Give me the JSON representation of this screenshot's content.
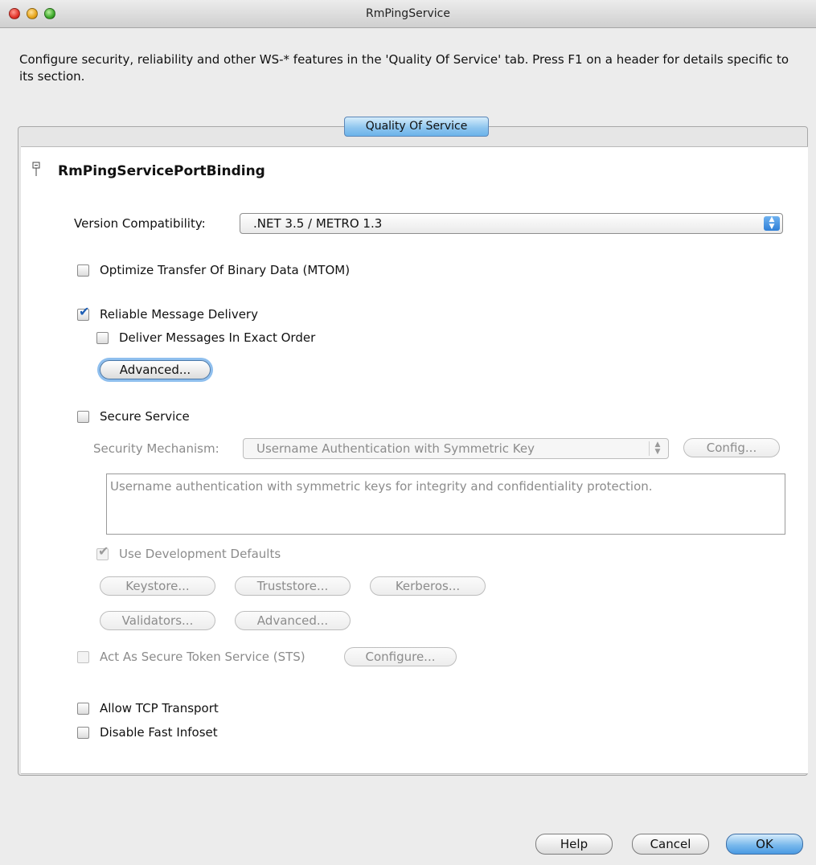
{
  "window": {
    "title": "RmPingService"
  },
  "intro_text": "Configure security, reliability and other WS-* features in the 'Quality Of Service' tab. Press F1 on a header for details specific to its section.",
  "tabs": [
    {
      "label": "Quality Of Service",
      "selected": true
    }
  ],
  "section": {
    "title": "RmPingServicePortBinding",
    "version": {
      "label": "Version Compatibility:",
      "value": ".NET 3.5 / METRO 1.3"
    },
    "mtom": {
      "label": "Optimize Transfer Of Binary Data (MTOM)",
      "checked": false
    },
    "reliable": {
      "label": "Reliable Message Delivery",
      "checked": true,
      "ordered": {
        "label": "Deliver Messages In Exact Order",
        "checked": false
      },
      "advanced_label": "Advanced..."
    },
    "secure": {
      "label": "Secure Service",
      "checked": false,
      "mechanism_label": "Security Mechanism:",
      "mechanism_value": "Username Authentication with Symmetric Key",
      "config_label": "Config...",
      "description": "Username authentication with symmetric keys for integrity and confidentiality protection.",
      "dev_defaults": {
        "label": "Use Development Defaults",
        "checked": true
      },
      "buttons": {
        "keystore": "Keystore...",
        "truststore": "Truststore...",
        "kerberos": "Kerberos...",
        "validators": "Validators...",
        "advanced": "Advanced..."
      },
      "sts": {
        "label": "Act As Secure Token Service (STS)",
        "checked": false,
        "configure_label": "Configure..."
      }
    },
    "tcp": {
      "label": "Allow TCP Transport",
      "checked": false
    },
    "fastinfoset": {
      "label": "Disable Fast Infoset",
      "checked": false
    }
  },
  "footer": {
    "help": "Help",
    "cancel": "Cancel",
    "ok": "OK"
  },
  "icons": {
    "close": "close-icon",
    "minimize": "minimize-icon",
    "zoom": "zoom-icon",
    "collapse": "collapse-icon",
    "select_arrows": "updown-arrows-icon",
    "checkmark": "checkmark-icon"
  },
  "colors": {
    "accent": "#6bb3ea",
    "disabled_text": "#8c8c8c"
  }
}
